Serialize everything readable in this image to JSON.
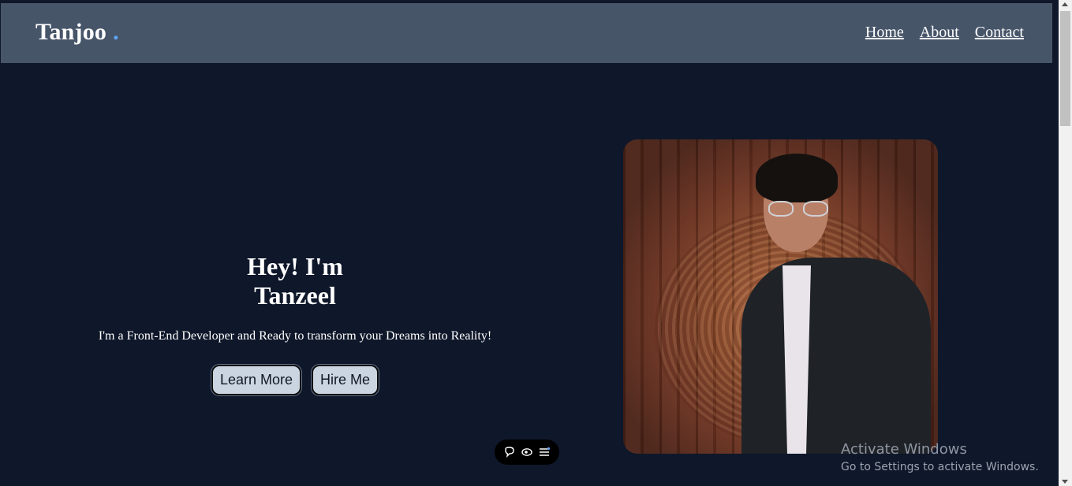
{
  "header": {
    "brand": "Tanjoo",
    "brand_dot": ".",
    "nav": [
      "Home",
      "About",
      "Contact"
    ]
  },
  "hero": {
    "title_line1": "Hey! I'm",
    "title_line2": "Tanzeel",
    "subtitle": "I'm a Front-End Developer and Ready to transform your Dreams into Reality!",
    "buttons": [
      "Learn More",
      "Hire Me"
    ]
  },
  "toolbar": {
    "icons": [
      "comment-icon",
      "eye-icon",
      "menu-icon"
    ]
  },
  "watermark": {
    "title": "Activate Windows",
    "subtitle": "Go to Settings to activate Windows."
  },
  "colors": {
    "background": "#0f172a",
    "navbar": "#475569",
    "accent": "#60a5fa",
    "button": "#cbd5e1"
  }
}
